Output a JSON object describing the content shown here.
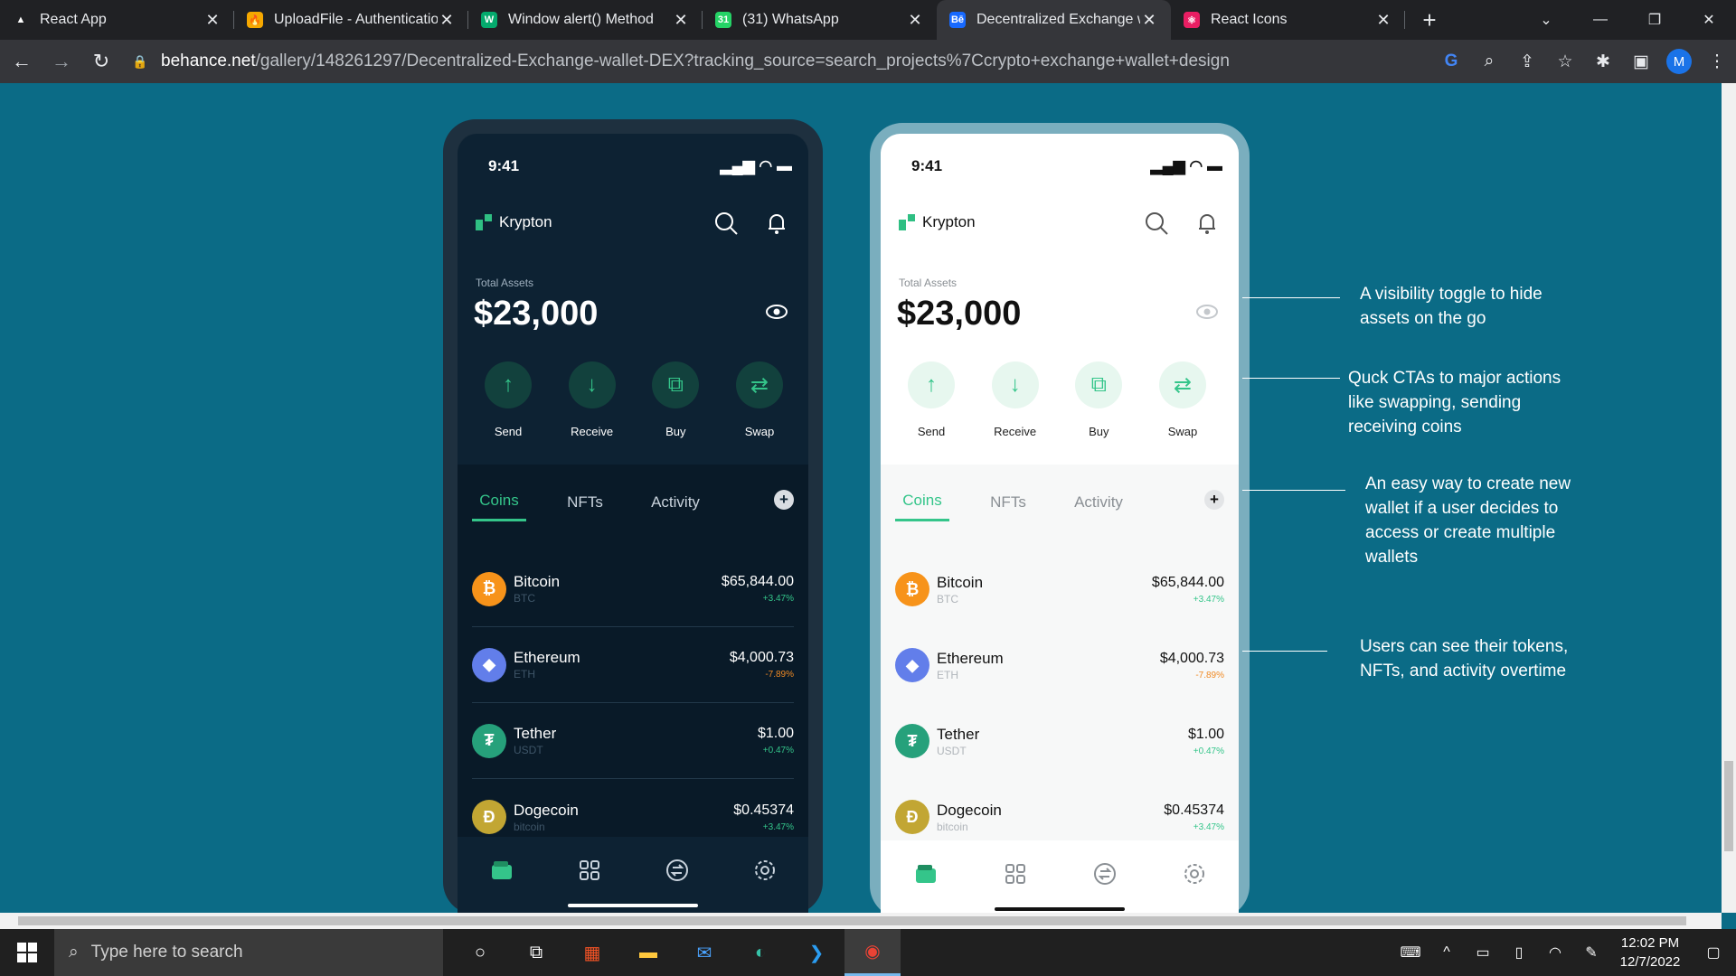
{
  "browser": {
    "tabs": [
      {
        "title": "React App",
        "fav_color": "#202124",
        "fav_glyph": "▲"
      },
      {
        "title": "UploadFile - Authenticatio",
        "fav_color": "#f6a800",
        "fav_glyph": "🔥"
      },
      {
        "title": "Window alert() Method",
        "fav_color": "#04aa6d",
        "fav_glyph": "W"
      },
      {
        "title": "(31) WhatsApp",
        "fav_color": "#25d366",
        "fav_glyph": "31"
      },
      {
        "title": "Decentralized Exchange wa",
        "fav_color": "#1769ff",
        "fav_glyph": "Bē"
      },
      {
        "title": "React Icons",
        "fav_color": "#e91e63",
        "fav_glyph": "⚛"
      }
    ],
    "url_host": "behance.net",
    "url_path": "/gallery/148261297/Decentralized-Exchange-wallet-DEX?tracking_source=search_projects%7Ccrypto+exchange+wallet+design",
    "profile_initial": "M"
  },
  "phones": {
    "time": "9:41",
    "brand": "Krypton",
    "total_label": "Total Assets",
    "total_value": "$23,000",
    "ctas": [
      "Send",
      "Receive",
      "Buy",
      "Swap"
    ],
    "tabs": [
      "Coins",
      "NFTs",
      "Activity"
    ],
    "coins": [
      {
        "name": "Bitcoin",
        "sym": "BTC",
        "price": "$65,844.00",
        "change": "+3.47%",
        "dir": "up",
        "color": "#f7931a",
        "glyph": "₿"
      },
      {
        "name": "Ethereum",
        "sym": "ETH",
        "price": "$4,000.73",
        "change": "-7.89%",
        "dir": "down",
        "color": "#627eea",
        "glyph": "◆"
      },
      {
        "name": "Tether",
        "sym": "USDT",
        "price": "$1.00",
        "change": "+0.47%",
        "dir": "up",
        "color": "#26a17b",
        "glyph": "₮"
      },
      {
        "name": "Dogecoin",
        "sym": "bitcoin",
        "price": "$0.45374",
        "change": "+3.47%",
        "dir": "up",
        "color": "#c2a633",
        "glyph": "Ð"
      }
    ]
  },
  "annotations": [
    "A visibility toggle to hide assets on the go",
    "Quck CTAs to  major actions like swapping, sending receiving coins",
    "An easy way to create new wallet if a user decides to access or create multiple wallets",
    "Users can see their tokens, NFTs, and activity overtime"
  ],
  "taskbar": {
    "search_placeholder": "Type here to search",
    "time": "12:02 PM",
    "date": "12/7/2022"
  }
}
